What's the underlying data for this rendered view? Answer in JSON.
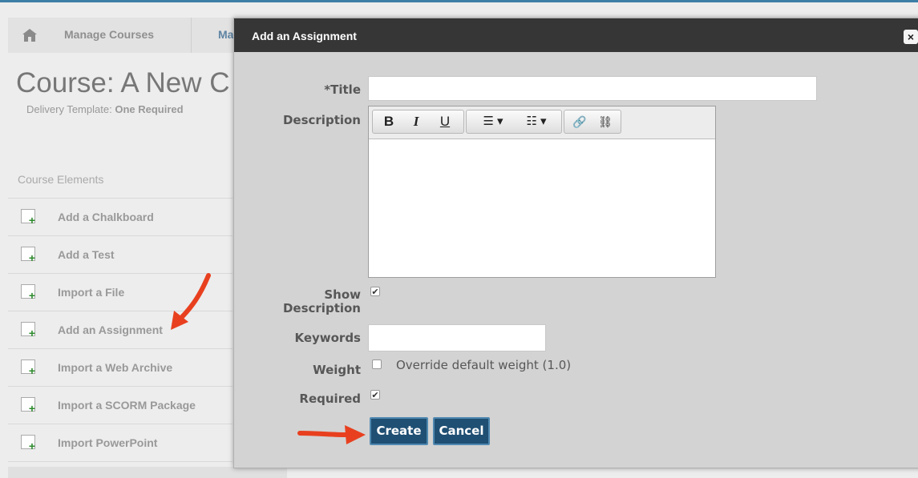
{
  "breadcrumb": {
    "item1": "Manage Courses",
    "item2": "Ma"
  },
  "course": {
    "title": "Course: A New C",
    "delivery_label": "Delivery Template:",
    "delivery_value": "One Required"
  },
  "elements": {
    "heading": "Course Elements",
    "items": [
      {
        "label": "Add a Chalkboard",
        "icon": "chalkboard-add-icon"
      },
      {
        "label": "Add a Test",
        "icon": "test-add-icon"
      },
      {
        "label": "Import a File",
        "icon": "file-import-icon"
      },
      {
        "label": "Add an Assignment",
        "icon": "assignment-add-icon"
      },
      {
        "label": "Import a Web Archive",
        "icon": "web-archive-import-icon"
      },
      {
        "label": "Import a SCORM Package",
        "icon": "scorm-import-icon"
      },
      {
        "label": "Import PowerPoint",
        "icon": "powerpoint-import-icon"
      }
    ]
  },
  "dialog": {
    "title": "Add an Assignment",
    "close_label": "×",
    "title_label": "*Title",
    "title_value": "",
    "description_label": "Description",
    "toolbar": {
      "bold": "B",
      "italic": "I",
      "underline": "U",
      "bullets": "☰ ▾",
      "numbers": "☷ ▾",
      "link": "🔗",
      "unlink": "⛓"
    },
    "show_description_label": "Show Description",
    "show_description_checked": true,
    "keywords_label": "Keywords",
    "keywords_value": "",
    "weight_label": "Weight",
    "weight_checkbox_text": "Override default weight (1.0)",
    "weight_checked": false,
    "required_label": "Required",
    "required_checked": true,
    "create_label": "Create",
    "cancel_label": "Cancel"
  },
  "colors": {
    "accent": "#1f4f73",
    "arrow": "#e8401f",
    "header": "#363636"
  }
}
